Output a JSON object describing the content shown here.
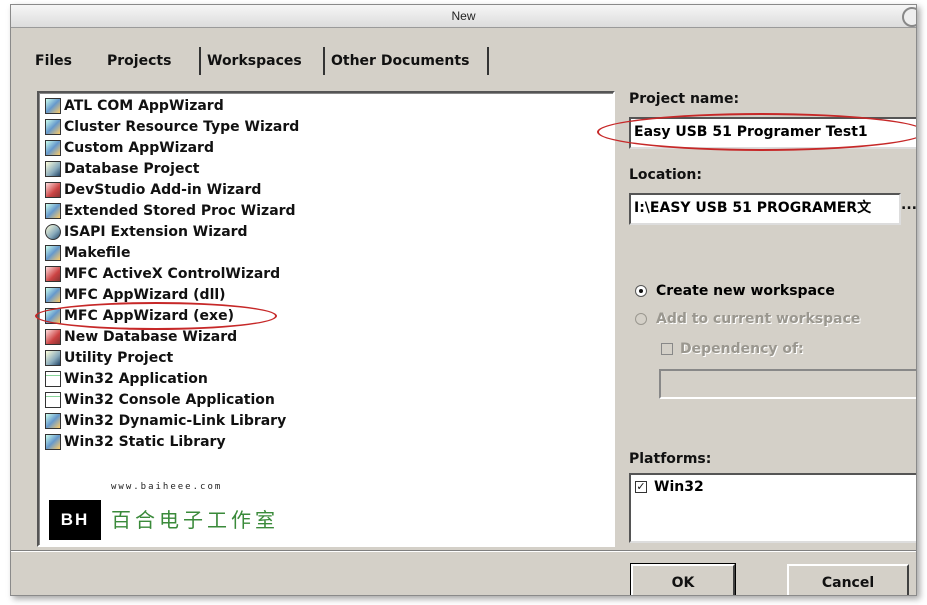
{
  "window": {
    "title": "New"
  },
  "tabs": [
    {
      "label": "Files"
    },
    {
      "label": "Projects"
    },
    {
      "label": "Workspaces"
    },
    {
      "label": "Other Documents"
    }
  ],
  "projects": [
    {
      "label": "ATL COM AppWizard",
      "icon": "atl-wizard-icon"
    },
    {
      "label": "Cluster Resource Type Wizard",
      "icon": "cluster-wizard-icon"
    },
    {
      "label": "Custom AppWizard",
      "icon": "custom-wizard-icon"
    },
    {
      "label": "Database Project",
      "icon": "database-icon"
    },
    {
      "label": "DevStudio Add-in Wizard",
      "icon": "addin-icon"
    },
    {
      "label": "Extended Stored Proc Wizard",
      "icon": "stored-proc-icon"
    },
    {
      "label": "ISAPI Extension Wizard",
      "icon": "globe-icon"
    },
    {
      "label": "Makefile",
      "icon": "makefile-icon"
    },
    {
      "label": "MFC ActiveX ControlWizard",
      "icon": "activex-icon"
    },
    {
      "label": "MFC AppWizard (dll)",
      "icon": "mfc-dll-icon"
    },
    {
      "label": "MFC AppWizard (exe)",
      "icon": "mfc-exe-icon"
    },
    {
      "label": "New Database Wizard",
      "icon": "database-wizard-icon"
    },
    {
      "label": "Utility Project",
      "icon": "utility-icon"
    },
    {
      "label": "Win32 Application",
      "icon": "win32-app-icon"
    },
    {
      "label": "Win32 Console Application",
      "icon": "console-icon"
    },
    {
      "label": "Win32 Dynamic-Link Library",
      "icon": "dll-icon"
    },
    {
      "label": "Win32 Static Library",
      "icon": "static-lib-icon"
    }
  ],
  "logo": {
    "badge": "BH",
    "url": "www.baiheee.com",
    "name": "百合电子工作室"
  },
  "form": {
    "project_name_label": "Project name:",
    "project_name_value": "Easy USB 51 Programer Test1",
    "location_label": "Location:",
    "location_value": "I:\\EASY USB 51 PROGRAMER文",
    "browse_label": "...",
    "create_new_label": "Create new workspace",
    "add_current_label": "Add to current workspace",
    "dependency_label": "Dependency of:",
    "platforms_label": "Platforms:",
    "platform_item": "Win32"
  },
  "buttons": {
    "ok": "OK",
    "cancel": "Cancel"
  },
  "colors": {
    "annotation": "#c62828",
    "dialog": "#d4d0c8"
  }
}
